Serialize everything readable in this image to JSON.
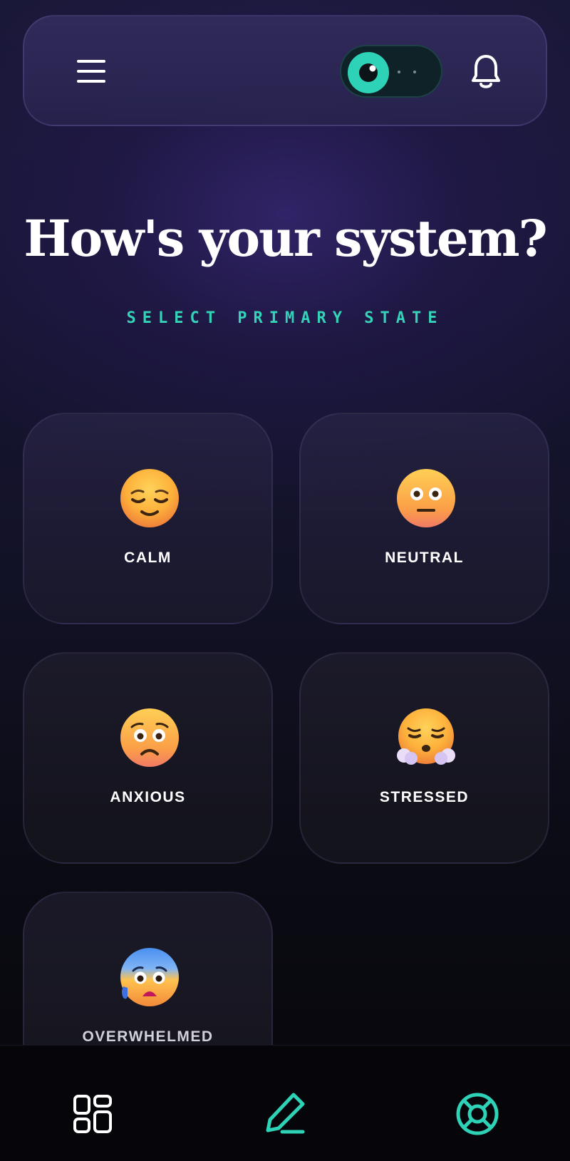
{
  "header": {
    "menu_icon": "hamburger-menu-icon",
    "toggle_icon": "eye-icon",
    "bell_icon": "bell-icon",
    "accent_color": "#2ed3b7"
  },
  "main": {
    "title": "How's your system?",
    "subtitle": "SELECT PRIMARY STATE"
  },
  "moods": [
    {
      "label": "CALM",
      "icon": "relieved-face-icon"
    },
    {
      "label": "NEUTRAL",
      "icon": "neutral-face-icon"
    },
    {
      "label": "ANXIOUS",
      "icon": "worried-face-icon"
    },
    {
      "label": "STRESSED",
      "icon": "steam-from-nose-face-icon"
    },
    {
      "label": "OVERWHELMED",
      "icon": "anxious-sweat-face-icon"
    }
  ],
  "bottom_nav": {
    "items": [
      {
        "icon": "dashboard-grid-icon"
      },
      {
        "icon": "pencil-icon",
        "active": true
      },
      {
        "icon": "lifebuoy-icon"
      }
    ]
  }
}
